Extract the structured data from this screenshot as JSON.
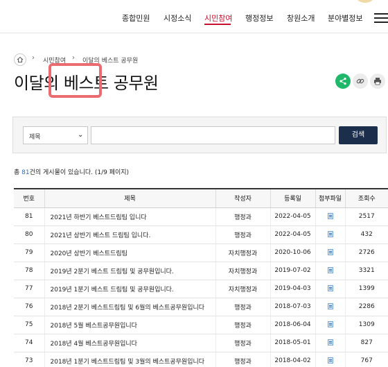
{
  "nav": {
    "items": [
      "종합민원",
      "시정소식",
      "시민참여",
      "행정정보",
      "창원소개",
      "분야별정보"
    ],
    "active_index": 2,
    "accent_color": "#c8102e"
  },
  "breadcrumb": {
    "home_icon": "home-icon",
    "items": [
      "시민참여",
      "이달의 베스트 공무원"
    ]
  },
  "page": {
    "title": "이달의 베스트 공무원",
    "highlight_color": "#ea6c72"
  },
  "share": {
    "icons": [
      "share-icon",
      "link-icon",
      "print-icon"
    ],
    "share_color": "#1fb86b"
  },
  "search": {
    "select_value": "제목",
    "input_value": "",
    "button_label": "검색",
    "button_color": "#1b2f4d"
  },
  "summary": {
    "prefix": "총 ",
    "count": "81",
    "suffix": "건의 게시물이 있습니다. (1/9 페이지)"
  },
  "table": {
    "headers": [
      "번호",
      "제목",
      "작성자",
      "등록일",
      "첨부파일",
      "조회수"
    ],
    "rows": [
      {
        "no": "81",
        "title": "2021년 하반기 베스트드림팀 입니다",
        "writer": "행정과",
        "date": "2022-04-05",
        "views": "2517"
      },
      {
        "no": "80",
        "title": "2021년 상반기 베스트 드림팀 입니다.",
        "writer": "행정과",
        "date": "2022-04-05",
        "views": "432"
      },
      {
        "no": "79",
        "title": "2020년 상반기 베스트드림팀",
        "writer": "자치행정과",
        "date": "2020-10-06",
        "views": "2726"
      },
      {
        "no": "78",
        "title": "2019년 2분기 베스트 드림팀 및 공무원입니다.",
        "writer": "자치행정과",
        "date": "2019-07-02",
        "views": "3321"
      },
      {
        "no": "77",
        "title": "2019년 1분기 베스트 드림팀 및 공무원입니다.",
        "writer": "자치행정과",
        "date": "2019-04-03",
        "views": "1399"
      },
      {
        "no": "76",
        "title": "2018년 2분기 베스트드림팀 및 6월의 베스트공무원입니다",
        "writer": "행정과",
        "date": "2018-07-03",
        "views": "2286"
      },
      {
        "no": "75",
        "title": "2018년 5월 베스트공무원입니다",
        "writer": "행정과",
        "date": "2018-06-04",
        "views": "1309"
      },
      {
        "no": "74",
        "title": "2018년 4월 베스트공무원입니다",
        "writer": "행정과",
        "date": "2018-05-01",
        "views": "827"
      },
      {
        "no": "73",
        "title": "2018년 1분기 베스트드림팀 및 3월의 베스트공무원입니다",
        "writer": "행정과",
        "date": "2018-04-02",
        "views": "767"
      }
    ]
  }
}
